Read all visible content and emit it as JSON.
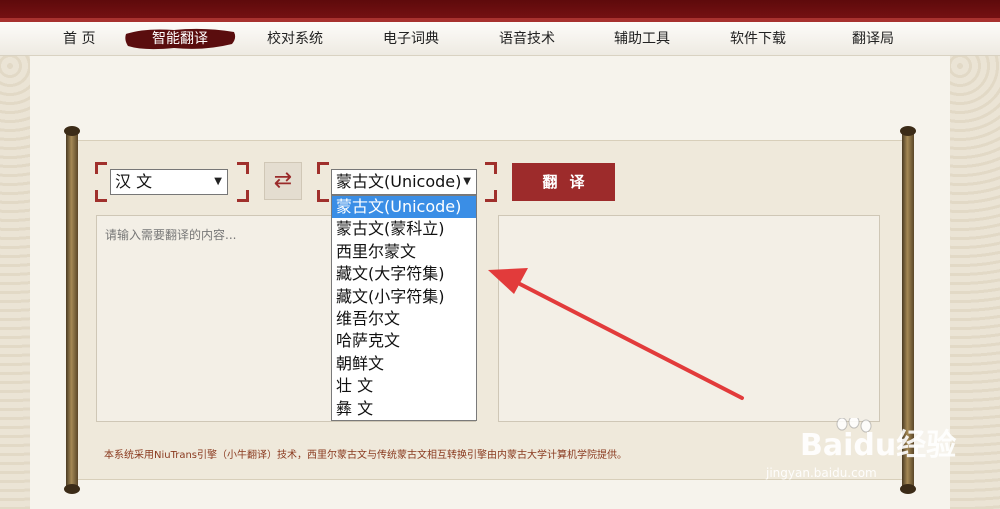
{
  "nav": {
    "items": [
      {
        "label": "首  页"
      },
      {
        "label": "智能翻译",
        "active": true
      },
      {
        "label": "校对系统"
      },
      {
        "label": "电子词典"
      },
      {
        "label": "语音技术"
      },
      {
        "label": "辅助工具"
      },
      {
        "label": "软件下载"
      },
      {
        "label": "翻译局"
      }
    ]
  },
  "translator": {
    "source_lang": "汉  文",
    "target_lang": "蒙古文(Unicode)",
    "swap_icon": "swap-arrows-icon",
    "translate_label": "翻译",
    "input_placeholder": "请输入需要翻译的内容...",
    "target_options": [
      "蒙古文(Unicode)",
      "蒙古文(蒙科立)",
      "西里尔蒙文",
      "藏文(大字符集)",
      "藏文(小字符集)",
      "维吾尔文",
      "哈萨克文",
      "朝鲜文",
      "壮  文",
      "彝  文"
    ],
    "notice": "本系统采用NiuTrans引擎（小牛翻译）技术，西里尔蒙古文与传统蒙古文相互转换引擎由内蒙古大学计算机学院提供。"
  },
  "watermark": {
    "brand": "Baidu经验",
    "url": "jingyan.baidu.com"
  },
  "colors": {
    "accent": "#9d2b2b",
    "selected": "#3a8ee6",
    "arrow": "#e23b3b"
  }
}
